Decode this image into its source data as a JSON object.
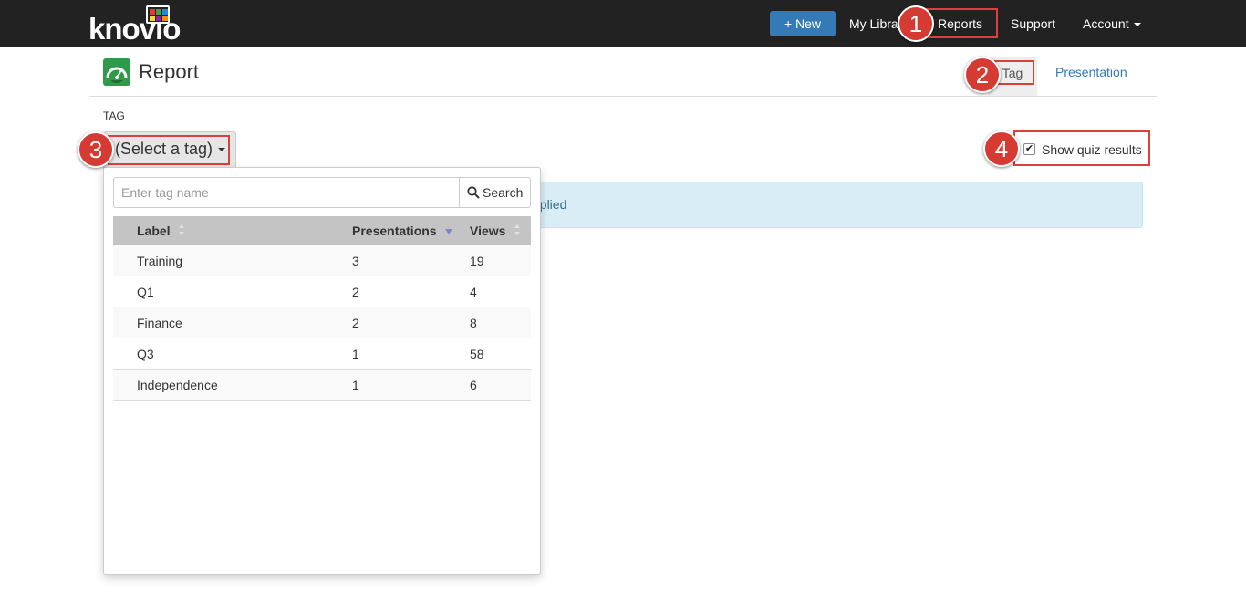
{
  "topbar": {
    "logo_text": "knovio",
    "new_button": "+ New",
    "nav": {
      "my_library": "My Libra",
      "reports": "Reports",
      "support": "Support",
      "account": "Account"
    }
  },
  "header": {
    "title": "Report",
    "tabs": [
      "Tag",
      "Presentation"
    ]
  },
  "filter": {
    "section_label": "TAG",
    "select_label": "(Select a tag)",
    "show_quiz_label": "Show quiz results",
    "show_quiz_checked": true,
    "alert_text": "pplied"
  },
  "dropdown": {
    "search_placeholder": "Enter tag name",
    "search_button": "Search",
    "columns": [
      "Label",
      "Presentations",
      "Views"
    ],
    "rows": [
      {
        "label": "Training",
        "presentations": "3",
        "views": "19"
      },
      {
        "label": "Q1",
        "presentations": "2",
        "views": "4"
      },
      {
        "label": "Finance",
        "presentations": "2",
        "views": "8"
      },
      {
        "label": "Q3",
        "presentations": "1",
        "views": "58"
      },
      {
        "label": "Independence",
        "presentations": "1",
        "views": "6"
      }
    ]
  },
  "annotations": [
    "1",
    "2",
    "3",
    "4"
  ],
  "colors": {
    "topbar": "#222222",
    "primary": "#337ab7",
    "highlight": "#d9413a",
    "badge": "#d63b33",
    "alert_bg": "#d9edf7",
    "report_icon": "#2e9a4a"
  }
}
